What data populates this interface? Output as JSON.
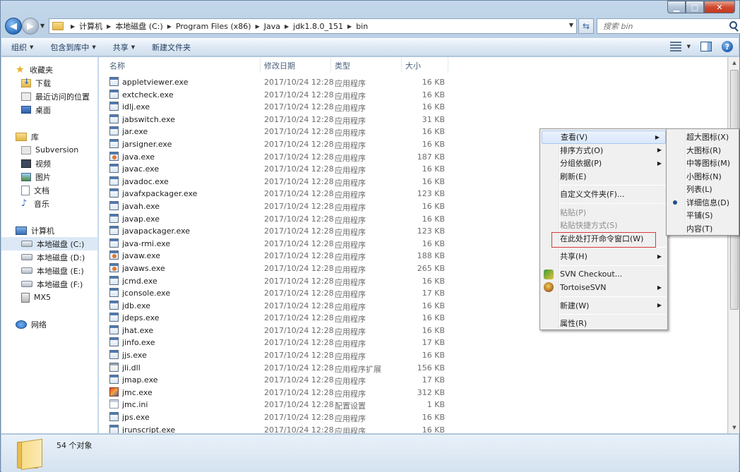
{
  "address": {
    "crumbs": [
      "计算机",
      "本地磁盘 (C:)",
      "Program Files (x86)",
      "Java",
      "jdk1.8.0_151",
      "bin"
    ],
    "search_placeholder": "搜索 bin"
  },
  "toolbar": {
    "organize": "组织",
    "include_library": "包含到库中",
    "share": "共享",
    "new_folder": "新建文件夹"
  },
  "nav": {
    "favorites": "收藏夹",
    "downloads": "下载",
    "recent": "最近访问的位置",
    "desktop": "桌面",
    "libraries": "库",
    "subversion": "Subversion",
    "videos": "视频",
    "pictures": "图片",
    "documents": "文档",
    "music": "音乐",
    "computer": "计算机",
    "drive_c": "本地磁盘 (C:)",
    "drive_d": "本地磁盘 (D:)",
    "drive_e": "本地磁盘 (E:)",
    "drive_f": "本地磁盘 (F:)",
    "mx5": "MX5",
    "network": "网络"
  },
  "columns": {
    "name": "名称",
    "date": "修改日期",
    "type": "类型",
    "size": "大小"
  },
  "files": [
    {
      "name": "appletviewer.exe",
      "date": "2017/10/24 12:28",
      "type": "应用程序",
      "size": "16 KB",
      "icon": "exe"
    },
    {
      "name": "extcheck.exe",
      "date": "2017/10/24 12:28",
      "type": "应用程序",
      "size": "16 KB",
      "icon": "exe"
    },
    {
      "name": "idlj.exe",
      "date": "2017/10/24 12:28",
      "type": "应用程序",
      "size": "16 KB",
      "icon": "exe"
    },
    {
      "name": "jabswitch.exe",
      "date": "2017/10/24 12:28",
      "type": "应用程序",
      "size": "31 KB",
      "icon": "exe"
    },
    {
      "name": "jar.exe",
      "date": "2017/10/24 12:28",
      "type": "应用程序",
      "size": "16 KB",
      "icon": "exe"
    },
    {
      "name": "jarsigner.exe",
      "date": "2017/10/24 12:28",
      "type": "应用程序",
      "size": "16 KB",
      "icon": "exe"
    },
    {
      "name": "java.exe",
      "date": "2017/10/24 12:28",
      "type": "应用程序",
      "size": "187 KB",
      "icon": "java"
    },
    {
      "name": "javac.exe",
      "date": "2017/10/24 12:28",
      "type": "应用程序",
      "size": "16 KB",
      "icon": "exe"
    },
    {
      "name": "javadoc.exe",
      "date": "2017/10/24 12:28",
      "type": "应用程序",
      "size": "16 KB",
      "icon": "exe"
    },
    {
      "name": "javafxpackager.exe",
      "date": "2017/10/24 12:28",
      "type": "应用程序",
      "size": "123 KB",
      "icon": "exe"
    },
    {
      "name": "javah.exe",
      "date": "2017/10/24 12:28",
      "type": "应用程序",
      "size": "16 KB",
      "icon": "exe"
    },
    {
      "name": "javap.exe",
      "date": "2017/10/24 12:28",
      "type": "应用程序",
      "size": "16 KB",
      "icon": "exe"
    },
    {
      "name": "javapackager.exe",
      "date": "2017/10/24 12:28",
      "type": "应用程序",
      "size": "123 KB",
      "icon": "exe"
    },
    {
      "name": "java-rmi.exe",
      "date": "2017/10/24 12:28",
      "type": "应用程序",
      "size": "16 KB",
      "icon": "exe"
    },
    {
      "name": "javaw.exe",
      "date": "2017/10/24 12:28",
      "type": "应用程序",
      "size": "188 KB",
      "icon": "java"
    },
    {
      "name": "javaws.exe",
      "date": "2017/10/24 12:28",
      "type": "应用程序",
      "size": "265 KB",
      "icon": "java"
    },
    {
      "name": "jcmd.exe",
      "date": "2017/10/24 12:28",
      "type": "应用程序",
      "size": "16 KB",
      "icon": "exe"
    },
    {
      "name": "jconsole.exe",
      "date": "2017/10/24 12:28",
      "type": "应用程序",
      "size": "17 KB",
      "icon": "exe"
    },
    {
      "name": "jdb.exe",
      "date": "2017/10/24 12:28",
      "type": "应用程序",
      "size": "16 KB",
      "icon": "exe"
    },
    {
      "name": "jdeps.exe",
      "date": "2017/10/24 12:28",
      "type": "应用程序",
      "size": "16 KB",
      "icon": "exe"
    },
    {
      "name": "jhat.exe",
      "date": "2017/10/24 12:28",
      "type": "应用程序",
      "size": "16 KB",
      "icon": "exe"
    },
    {
      "name": "jinfo.exe",
      "date": "2017/10/24 12:28",
      "type": "应用程序",
      "size": "17 KB",
      "icon": "exe"
    },
    {
      "name": "jjs.exe",
      "date": "2017/10/24 12:28",
      "type": "应用程序",
      "size": "16 KB",
      "icon": "exe"
    },
    {
      "name": "jli.dll",
      "date": "2017/10/24 12:28",
      "type": "应用程序扩展",
      "size": "156 KB",
      "icon": "dll"
    },
    {
      "name": "jmap.exe",
      "date": "2017/10/24 12:28",
      "type": "应用程序",
      "size": "17 KB",
      "icon": "exe"
    },
    {
      "name": "jmc.exe",
      "date": "2017/10/24 12:28",
      "type": "应用程序",
      "size": "312 KB",
      "icon": "jmc"
    },
    {
      "name": "jmc.ini",
      "date": "2017/10/24 12:28",
      "type": "配置设置",
      "size": "1 KB",
      "icon": "ini"
    },
    {
      "name": "jps.exe",
      "date": "2017/10/24 12:28",
      "type": "应用程序",
      "size": "16 KB",
      "icon": "exe"
    },
    {
      "name": "jrunscript.exe",
      "date": "2017/10/24 12:28",
      "type": "应用程序",
      "size": "16 KB",
      "icon": "exe"
    }
  ],
  "status": {
    "count": "54 个对象"
  },
  "context_menu": {
    "view": "查看(V)",
    "sort_by": "排序方式(O)",
    "group_by": "分组依据(P)",
    "refresh": "刷新(E)",
    "customize_folder": "自定义文件夹(F)...",
    "paste": "粘贴(P)",
    "paste_shortcut": "粘贴快捷方式(S)",
    "open_cmd_here": "在此处打开命令窗口(W)",
    "share_with": "共享(H)",
    "svn_checkout": "SVN Checkout...",
    "tortoisesvn": "TortoiseSVN",
    "new": "新建(W)",
    "properties": "属性(R)"
  },
  "view_submenu": {
    "extra_large_icons": "超大图标(X)",
    "large_icons": "大图标(R)",
    "medium_icons": "中等图标(M)",
    "small_icons": "小图标(N)",
    "list": "列表(L)",
    "details": "详细信息(D)",
    "tiles": "平铺(S)",
    "content": "内容(T)"
  },
  "colors": {
    "highlight_box": "#d93a3a",
    "menu_hover": "#d9e7fa"
  }
}
